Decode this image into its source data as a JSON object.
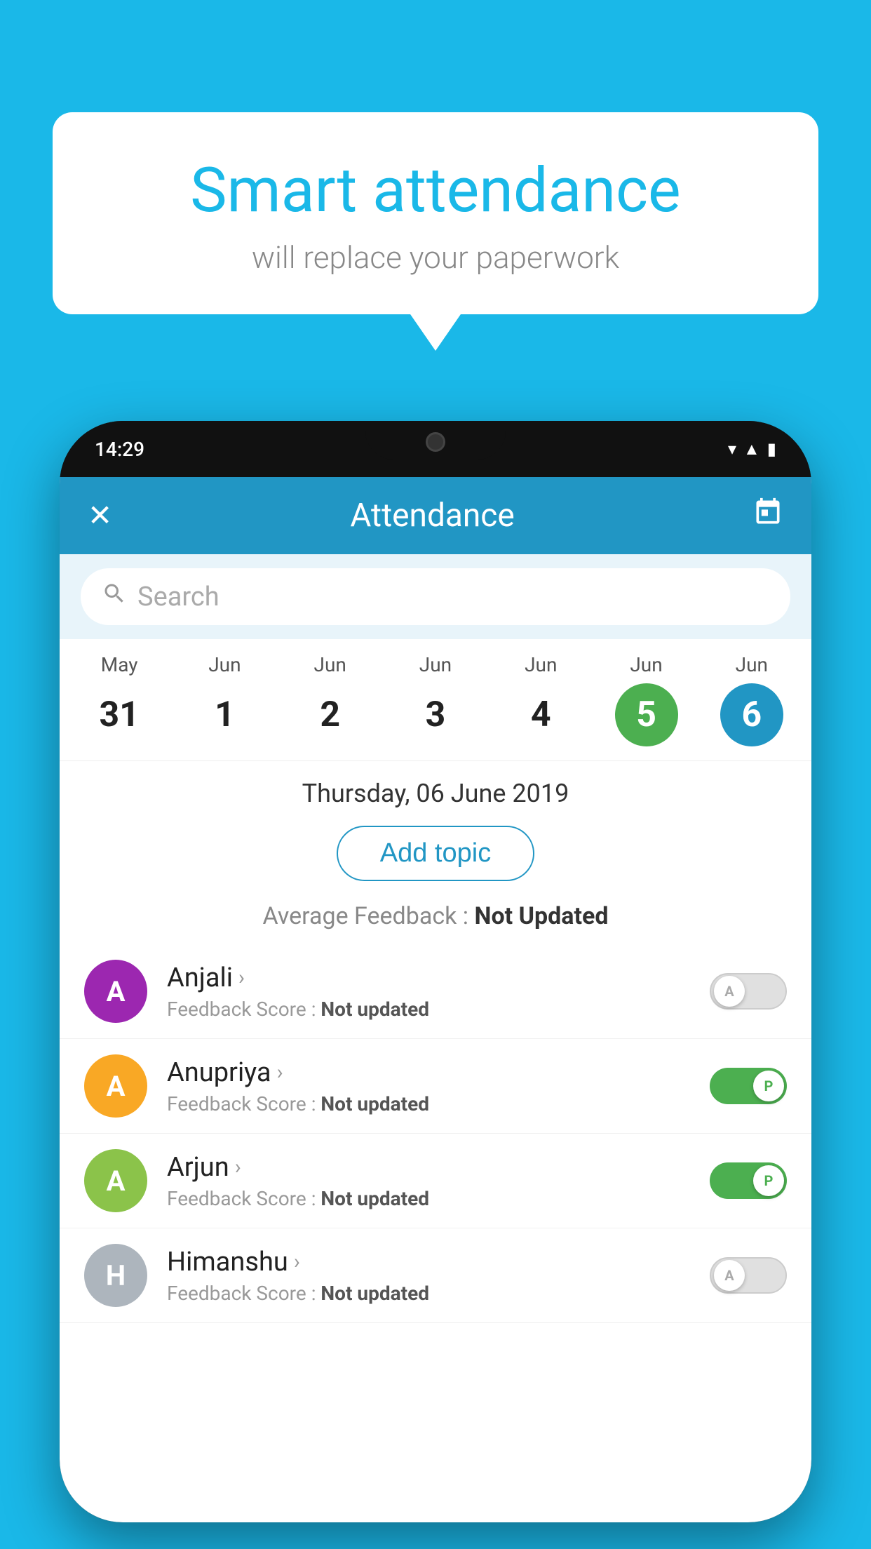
{
  "background_color": "#1ab8e8",
  "speech_bubble": {
    "title": "Smart attendance",
    "subtitle": "will replace your paperwork"
  },
  "phone": {
    "status_bar": {
      "time": "14:29",
      "icons": [
        "wifi",
        "signal",
        "battery"
      ]
    },
    "app_header": {
      "close_label": "✕",
      "title": "Attendance",
      "calendar_icon": "📅"
    },
    "search": {
      "placeholder": "Search"
    },
    "calendar": {
      "items": [
        {
          "month": "May",
          "day": "31",
          "state": "normal"
        },
        {
          "month": "Jun",
          "day": "1",
          "state": "normal"
        },
        {
          "month": "Jun",
          "day": "2",
          "state": "normal"
        },
        {
          "month": "Jun",
          "day": "3",
          "state": "normal"
        },
        {
          "month": "Jun",
          "day": "4",
          "state": "normal"
        },
        {
          "month": "Jun",
          "day": "5",
          "state": "today"
        },
        {
          "month": "Jun",
          "day": "6",
          "state": "selected"
        }
      ]
    },
    "selected_date": "Thursday, 06 June 2019",
    "add_topic_label": "Add topic",
    "avg_feedback_label": "Average Feedback :",
    "avg_feedback_value": "Not Updated",
    "students": [
      {
        "name": "Anjali",
        "avatar_letter": "A",
        "avatar_color": "#9c27b0",
        "feedback_label": "Feedback Score :",
        "feedback_value": "Not updated",
        "toggle_state": "off",
        "toggle_letter": "A"
      },
      {
        "name": "Anupriya",
        "avatar_letter": "A",
        "avatar_color": "#f9a825",
        "feedback_label": "Feedback Score :",
        "feedback_value": "Not updated",
        "toggle_state": "on",
        "toggle_letter": "P"
      },
      {
        "name": "Arjun",
        "avatar_letter": "A",
        "avatar_color": "#8bc34a",
        "feedback_label": "Feedback Score :",
        "feedback_value": "Not updated",
        "toggle_state": "on",
        "toggle_letter": "P"
      },
      {
        "name": "Himanshu",
        "avatar_letter": "H",
        "avatar_color": "#adb5bd",
        "feedback_label": "Feedback Score :",
        "feedback_value": "Not updated",
        "toggle_state": "off",
        "toggle_letter": "A"
      }
    ]
  }
}
